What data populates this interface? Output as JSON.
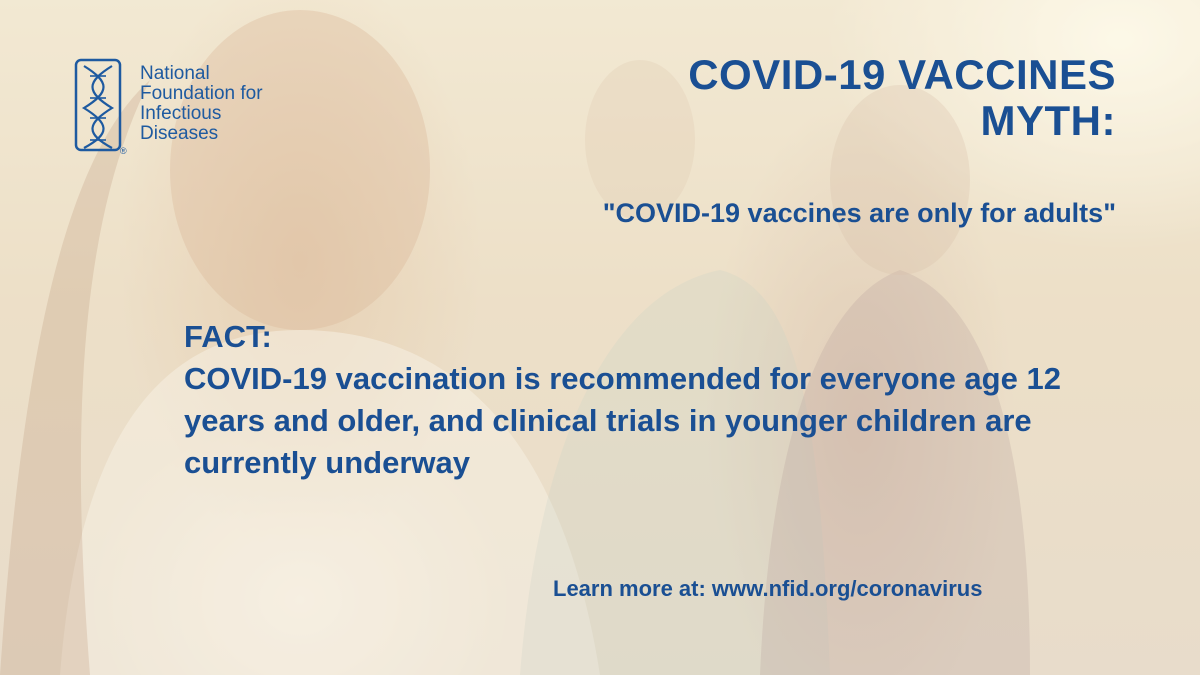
{
  "logo": {
    "line1": "National",
    "line2": "Foundation for",
    "line3": "Infectious",
    "line4": "Diseases",
    "mark_icon": "dna-helix-icon",
    "registered": "®"
  },
  "headline": {
    "line1": "COVID-19 VACCINES",
    "line2": "MYTH:"
  },
  "myth_quote": "\"COVID-19 vaccines are only for adults\"",
  "fact": {
    "label": "FACT:",
    "body": "COVID-19 vaccination is recommended for everyone age 12 years and older, and clinical trials in younger children are currently underway"
  },
  "learn_more": "Learn more at: www.nfid.org/coronavirus",
  "colors": {
    "text_primary": "#1a4f93",
    "logo_blue": "#1e5aa0"
  }
}
